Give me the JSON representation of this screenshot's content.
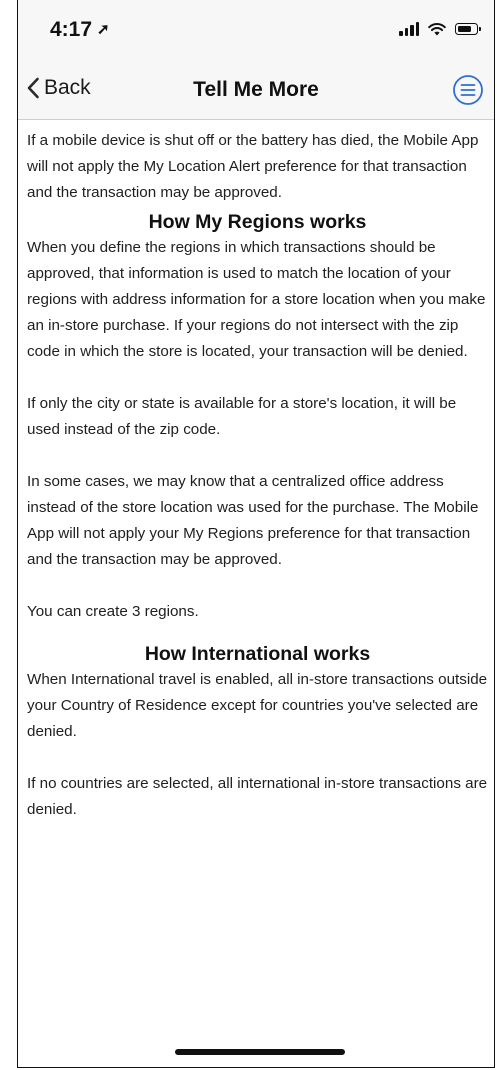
{
  "status_bar": {
    "time": "4:17",
    "location_arrow": "➚"
  },
  "nav": {
    "back_label": "Back",
    "title": "Tell Me More",
    "menu_icon": "menu-circle-icon"
  },
  "content": {
    "intro": "If a mobile device is shut off or the battery has died, the Mobile App will not apply the My Location Alert preference for that transaction and the transaction may be approved.",
    "regions": {
      "heading": "How My Regions works",
      "paragraphs": [
        "When you define the regions in which transactions should be approved, that information is used to match the location of your regions with address information for a store location when you make an in-store purchase. If your regions do not intersect with the zip code in which the store is located, your transaction will be denied.",
        "If only the city or state is available for a store's location, it will be used instead of the zip code.",
        "In some cases, we may know that a centralized office address instead of the store location was used for the purchase. The Mobile App will not apply your My Regions preference for that transaction and the transaction may be approved.",
        "You can create 3 regions."
      ]
    },
    "international": {
      "heading": "How International works",
      "paragraphs": [
        "When International travel is enabled, all in-store transactions outside your Country of Residence except for countries you've selected are denied.",
        "If no countries are selected, all international in-store transactions are denied."
      ]
    }
  },
  "colors": {
    "accent": "#2f6fcf",
    "nav_background": "#f7f7f7",
    "text": "#1f1f1f"
  }
}
